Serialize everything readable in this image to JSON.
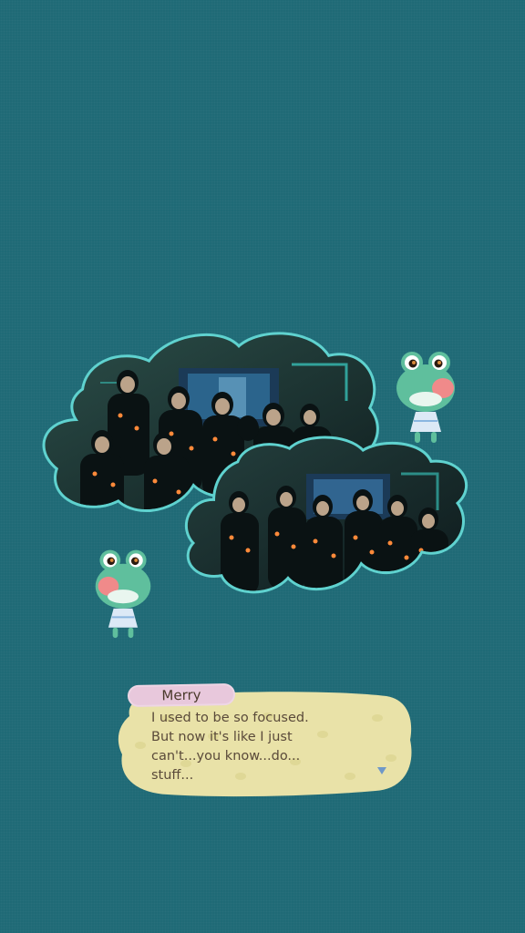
{
  "dialog": {
    "speaker": "Merry",
    "lines": [
      "I used to be so focused.",
      "But now it's like I just",
      "can't...you know...do...",
      "stuff..."
    ]
  },
  "photos": [
    {
      "icon": "group-photo-laser-tag-1"
    },
    {
      "icon": "group-photo-laser-tag-2"
    }
  ],
  "characters": [
    {
      "icon": "frog-villager-icon"
    },
    {
      "icon": "frog-villager-icon"
    }
  ],
  "colors": {
    "background": "#1f6a76",
    "frame": "#5fd2cf",
    "dialog_bubble": "#e9e2a8",
    "name_tag": "#e8c8dc",
    "text": "#5a4a3a"
  }
}
